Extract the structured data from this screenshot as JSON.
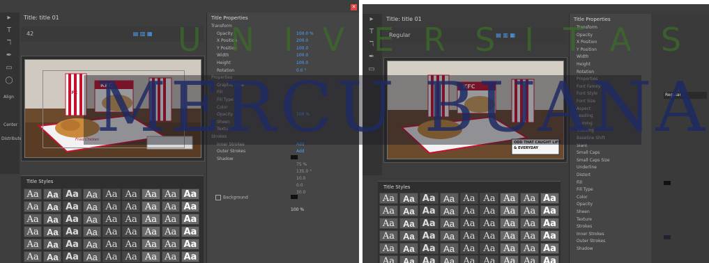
{
  "left_window": {
    "tab_title": "Title: title 01",
    "options_value": "42",
    "properties_title": "Title Properties",
    "properties": [
      {
        "label": "Transform",
        "value": ""
      },
      {
        "label": "Opacity",
        "value": "100.0 %"
      },
      {
        "label": "X Position",
        "value": "200.0"
      },
      {
        "label": "Y Position",
        "value": "100.0"
      },
      {
        "label": "Width",
        "value": "100.0"
      },
      {
        "label": "Height",
        "value": "100.0"
      },
      {
        "label": "Rotation",
        "value": "0.0 °"
      },
      {
        "label": "Properties",
        "value": ""
      },
      {
        "label": "Graphic Type",
        "value": ""
      },
      {
        "label": "Fill",
        "value": ""
      },
      {
        "label": "Fill Type",
        "value": ""
      },
      {
        "label": "Color",
        "value": ""
      },
      {
        "label": "Opacity",
        "value": "100 %"
      },
      {
        "label": "Sheen",
        "value": ""
      },
      {
        "label": "Texture",
        "value": ""
      },
      {
        "label": "Strokes",
        "value": ""
      },
      {
        "label": "Inner Strokes",
        "value": "Add"
      },
      {
        "label": "Outer Strokes",
        "value": "Add"
      },
      {
        "label": "Shadow",
        "value": ""
      }
    ],
    "shadow_values": [
      "75 %",
      "135.0 °",
      "10.0",
      "0.0",
      "30.0"
    ],
    "background_label": "Background",
    "background_value": "100 %",
    "title_styles_label": "Title Styles",
    "left_labels": [
      "Align",
      "Center",
      "Distribute"
    ]
  },
  "right_window": {
    "tab_title": "Title: title 01",
    "options_value": "Regular",
    "properties_title": "Title Properties",
    "properties": [
      "Transform",
      "Opacity",
      "X Position",
      "Y Position",
      "Width",
      "Height",
      "Rotation",
      "Properties",
      "Font Family",
      "Font Style",
      "Font Size",
      "Aspect",
      "Leading",
      "Kerning",
      "Tracking",
      "Baseline Shift",
      "Slant",
      "Small Caps",
      "Small Caps Size",
      "Underline",
      "Distort",
      "Fill",
      "Fill Type",
      "Color",
      "Opacity",
      "Sheen",
      "Texture",
      "Strokes",
      "Inner Strokes",
      "Outer Strokes",
      "Shadow"
    ],
    "side_label": "Regular",
    "caption_line1": "ODD THAT CAUGHT LIFE",
    "caption_line2": "& EVERYDAY",
    "title_styles_label": "Title Styles"
  },
  "photo": {
    "brand": "KFC",
    "cup_label": "KFC",
    "box_text": "Fried Chicken"
  },
  "swatches": [
    "Aa",
    "Aa",
    "Aa",
    "Aa",
    "Aa",
    "Aa",
    "Aa",
    "Aa",
    "Aa",
    "Aa",
    "Aa",
    "Aa",
    "Aa",
    "Aa",
    "Aa",
    "Aa",
    "Aa",
    "Aa",
    "Aa",
    "Aa",
    "Aa",
    "Aa",
    "Aa",
    "Aa",
    "Aa",
    "Aa",
    "Aa",
    "Aa",
    "Aa",
    "Aa",
    "Aa",
    "Aa",
    "Aa",
    "Aa",
    "Aa",
    "Aa",
    "Aa",
    "Aa",
    "Aa",
    "Aa",
    "Aa",
    "Aa",
    "Aa",
    "Aa",
    "Aa",
    "Aa",
    "Aa",
    "Aa",
    "Aa",
    "Aa",
    "Aa",
    "Aa",
    "Aa",
    "Aa"
  ],
  "watermark": {
    "top": "UNIVERSITAS",
    "bottom": "MERCU BUANA"
  },
  "colors": {
    "accent_blue": "#4ea3ff",
    "watermark_green": "#3c6b2a",
    "watermark_navy": "#1f2a63",
    "kfc_red": "#c8102e"
  }
}
